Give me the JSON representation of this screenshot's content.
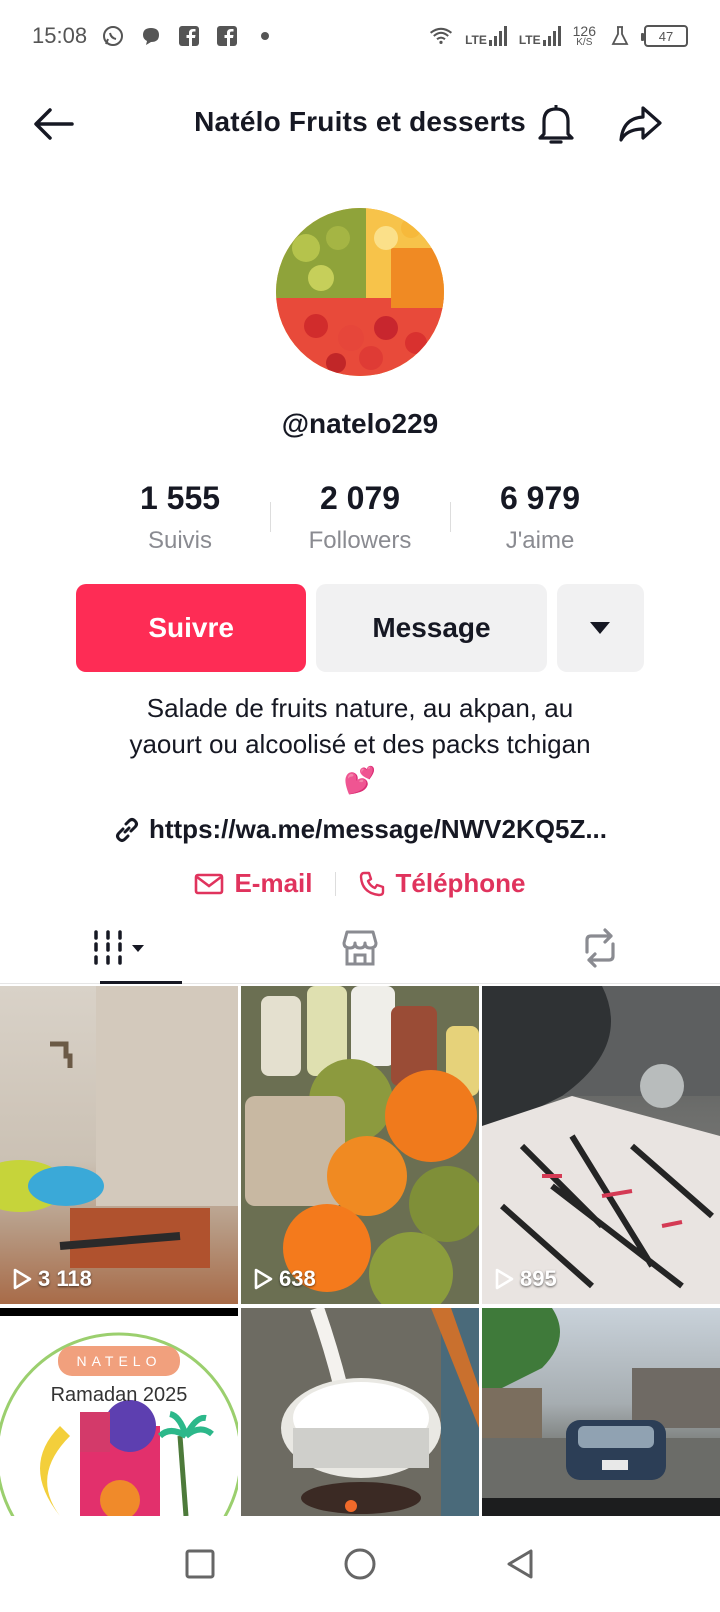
{
  "status_bar": {
    "time": "15:08",
    "app_icons": [
      "whatsapp-icon",
      "chat-bubble-icon",
      "facebook-icon",
      "facebook-icon",
      "dot-icon"
    ],
    "net_1": "LTE",
    "net_2": "LTE",
    "speed_value": "126",
    "speed_unit": "K/S",
    "battery": "47"
  },
  "header": {
    "title": "Natélo Fruits et desserts"
  },
  "profile": {
    "username": "@natelo229",
    "stats": [
      {
        "value": "1 555",
        "label": "Suivis"
      },
      {
        "value": "2 079",
        "label": "Followers"
      },
      {
        "value": "6 979",
        "label": "J'aime"
      }
    ],
    "buttons": {
      "follow": "Suivre",
      "message": "Message"
    },
    "bio_line1": "Salade de fruits nature, au akpan, au",
    "bio_line2": "yaourt ou alcoolisé et des packs tchigan",
    "bio_emoji": "💕",
    "link": "https://wa.me/message/NWV2KQ5Z...",
    "contact_email": "E-mail",
    "contact_phone": "Téléphone"
  },
  "tabs": [
    "videos-grid-tab",
    "shop-tab",
    "reposts-tab"
  ],
  "videos": [
    {
      "views": "3 118"
    },
    {
      "views": "638"
    },
    {
      "views": "895"
    },
    {
      "banner": "NATELO",
      "caption": "Ramadan 2025"
    },
    {},
    {}
  ],
  "colors": {
    "accent": "#fe2c55",
    "contact": "#e0335d",
    "secondary_button": "#f1f1f2",
    "muted_text": "#8a8b91"
  }
}
